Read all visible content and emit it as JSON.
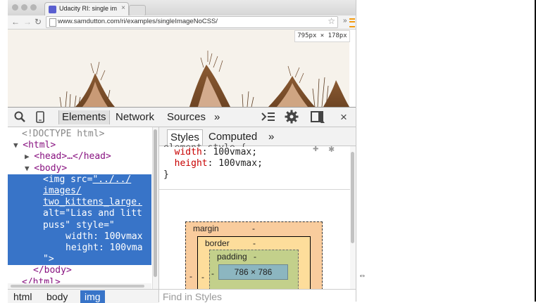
{
  "browser": {
    "tab_title": "Udacity RI: single image, n",
    "url": "www.samdutton.com/ri/examples/singleImageNoCSS/",
    "overflow_label": "»"
  },
  "viewport": {
    "dimensions_label": "795px × 178px"
  },
  "devtools": {
    "tabs": [
      "Elements",
      "Network",
      "Sources",
      "»"
    ],
    "close_label": "×"
  },
  "elements_tree": {
    "doctype": "<!DOCTYPE html>",
    "html_open": "<html>",
    "head": "<head>…</head>",
    "body_open": "<body>",
    "img_tag": "<img",
    "src_attr": "src",
    "src_val_1": "\"../../",
    "src_val_2": "images/",
    "src_val_3": "two_kittens_large.",
    "alt_attr": "alt",
    "alt_val": "\"Lias and litt",
    "alt_val_2": "puss\"",
    "style_attr": "style",
    "style_val_1": "=\"",
    "style_line_width": "width: 100vmax",
    "style_line_height": "height: 100vma",
    "close_quote": "\">",
    "body_close": "</body>",
    "html_close": "</html>"
  },
  "breadcrumbs": [
    "html",
    "body",
    "img"
  ],
  "styles_pane": {
    "tabs": [
      "Styles",
      "Computed",
      "»"
    ],
    "rule_partial": "element.style {",
    "props": [
      {
        "name": "width",
        "value": "100vmax;"
      },
      {
        "name": "height",
        "value": "100vmax;"
      }
    ],
    "rule_close": "}",
    "filter_placeholder": "Find in Styles"
  },
  "box_model": {
    "margin_label": "margin",
    "margin_value": "-",
    "border_label": "border",
    "border_value": "-",
    "padding_label": "padding",
    "padding_value": "-",
    "content_size": "786 × 786",
    "side_value": "-"
  },
  "colors": {
    "selection": "#3874c8",
    "margin": "#f9cc9d",
    "border": "#fddd9b",
    "padding": "#c3d08b",
    "content": "#8cb6c0"
  }
}
